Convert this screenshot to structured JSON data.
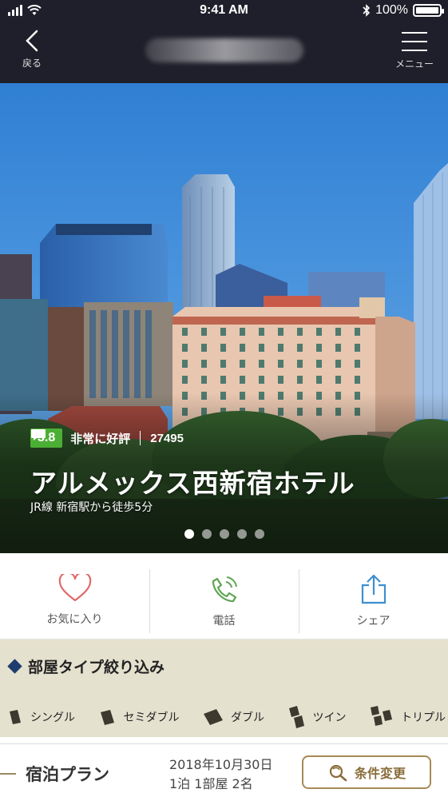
{
  "status_bar": {
    "time": "9:41 AM",
    "battery": "100%",
    "battery_level": 1.0
  },
  "nav": {
    "back_label": "戻る",
    "menu_label": "メニュー"
  },
  "hotel": {
    "score": "3.8",
    "rating_label": "非常に好評",
    "review_count": "27495",
    "name": "アルメックス西新宿ホテル",
    "access": "JR線 新宿駅から徒歩5分",
    "carousel": {
      "total": 5,
      "active": 1
    }
  },
  "actions": [
    {
      "label": "お気に入り",
      "icon": "heart-icon",
      "color": "#e06a6a"
    },
    {
      "label": "電話",
      "icon": "phone-icon",
      "color": "#5fa653"
    },
    {
      "label": "シェア",
      "icon": "share-icon",
      "color": "#3e8fd0"
    }
  ],
  "filter": {
    "title": "部屋タイプ絞り込み",
    "room_types": [
      {
        "label": "シングル",
        "icon": "single-bed-icon"
      },
      {
        "label": "セミダブル",
        "icon": "semi-double-bed-icon"
      },
      {
        "label": "ダブル",
        "icon": "double-bed-icon"
      },
      {
        "label": "ツイン",
        "icon": "twin-bed-icon"
      },
      {
        "label": "トリプル",
        "icon": "triple-bed-icon"
      }
    ]
  },
  "plan": {
    "title": "宿泊プラン",
    "date": "2018年10月30日",
    "details": "1泊 1部屋 2名",
    "change_label": "条件変更"
  },
  "colors": {
    "header_bg": "#1f1f2b",
    "score_green": "#4caf35",
    "filter_bg": "#e5e1cf",
    "accent_gold": "#a68a55",
    "diamond_navy": "#1e3d6e"
  }
}
